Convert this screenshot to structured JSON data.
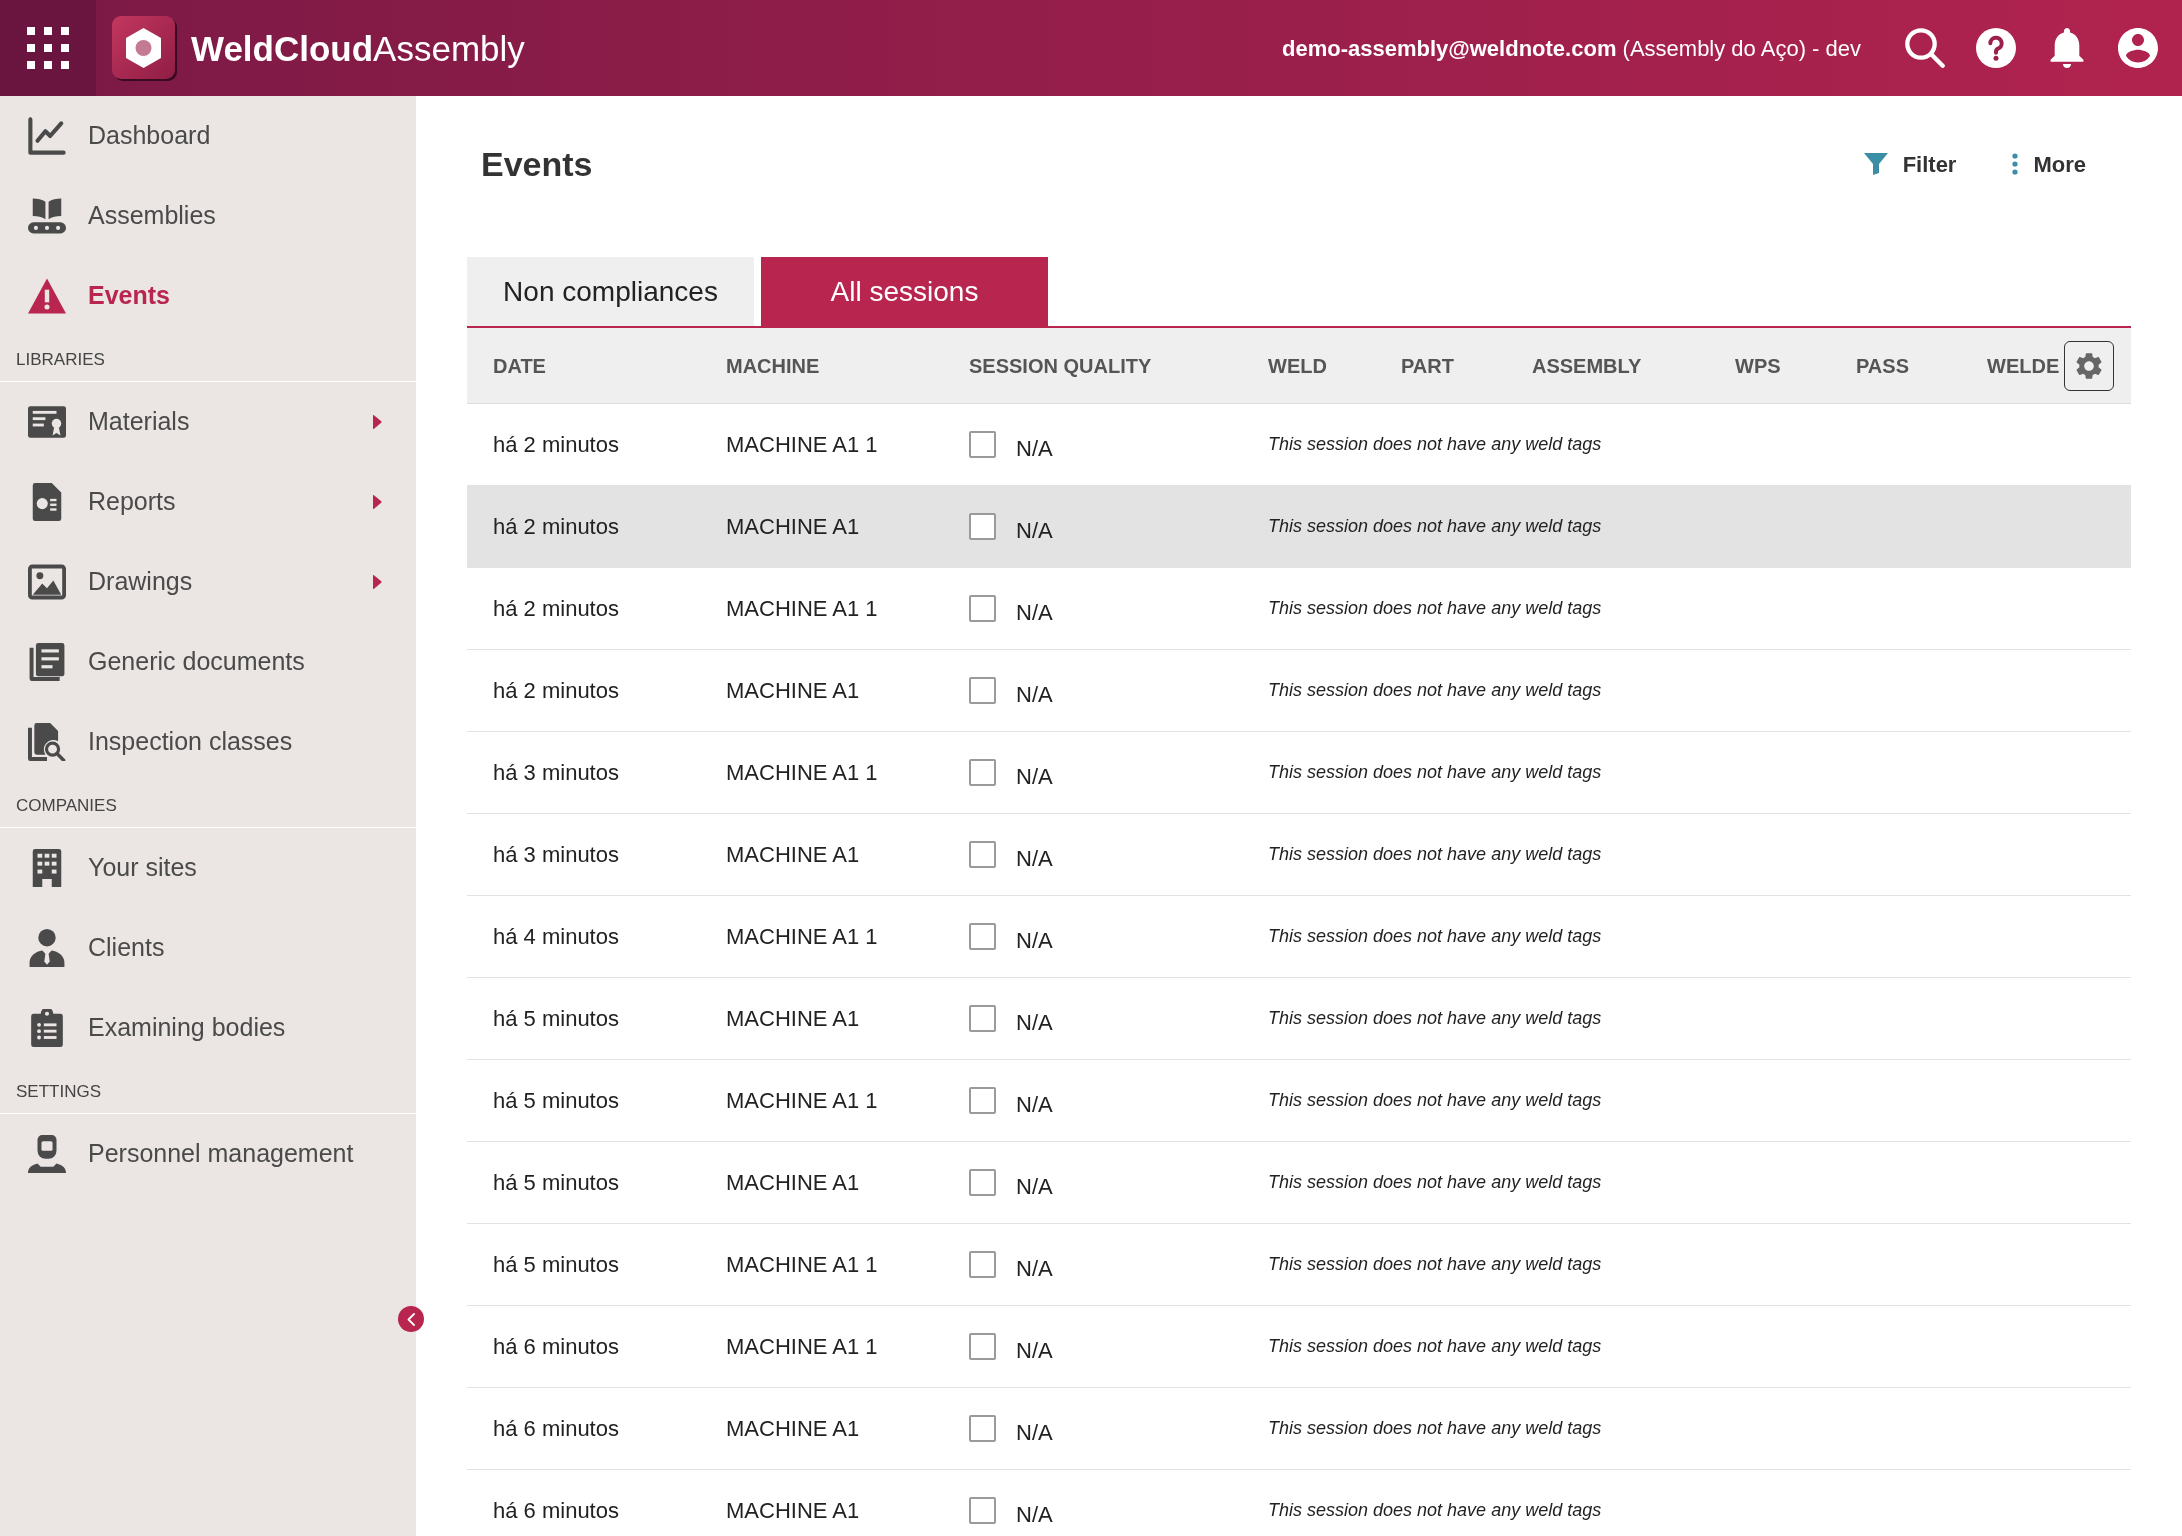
{
  "header": {
    "app_title": "**WeldCloud**Assembly",
    "user_info": "**demo-assembly@weldnote.com** (Assembly do Aço) - dev"
  },
  "sidebar": {
    "sections": [
      {
        "items": [
          {
            "label": "Dashboard",
            "selected": false,
            "has_submenu": false
          },
          {
            "label": "Assemblies",
            "selected": false,
            "has_submenu": false
          },
          {
            "label": "Events",
            "selected": true,
            "has_submenu": false
          }
        ]
      },
      {
        "title": "LIBRARIES",
        "items": [
          {
            "label": "Materials",
            "selected": false,
            "has_submenu": true
          },
          {
            "label": "Reports",
            "selected": false,
            "has_submenu": true
          },
          {
            "label": "Drawings",
            "selected": false,
            "has_submenu": true
          },
          {
            "label": "Generic documents",
            "selected": false,
            "has_submenu": false
          },
          {
            "label": "Inspection classes",
            "selected": false,
            "has_submenu": false
          }
        ]
      },
      {
        "title": "COMPANIES",
        "items": [
          {
            "label": "Your sites",
            "selected": false,
            "has_submenu": false
          },
          {
            "label": "Clients",
            "selected": false,
            "has_submenu": false
          },
          {
            "label": "Examining bodies",
            "selected": false,
            "has_submenu": false
          }
        ]
      },
      {
        "title": "SETTINGS",
        "items": [
          {
            "label": "Personnel management",
            "selected": false,
            "has_submenu": false
          }
        ]
      }
    ]
  },
  "page": {
    "title": "Events",
    "actions": [
      {
        "label": "Filter"
      },
      {
        "label": "More"
      }
    ]
  },
  "tabs": [
    {
      "label": "Non compliances",
      "selected": false
    },
    {
      "label": "All sessions",
      "selected": true
    }
  ],
  "table": {
    "columns": [
      "DATE",
      "MACHINE",
      "SESSION QUALITY",
      "WELD",
      "PART",
      "ASSEMBLY",
      "WPS",
      "PASS",
      "WELDE"
    ],
    "rows": [
      {
        "date": "há 2 minutos",
        "machine": "MACHINE A1 1",
        "quality_checked": false,
        "quality": "N/A",
        "weld_tags": "This session does not have any weld tags",
        "highlighted": false
      },
      {
        "date": "há 2 minutos",
        "machine": "MACHINE A1",
        "quality_checked": false,
        "quality": "N/A",
        "weld_tags": "This session does not have any weld tags",
        "highlighted": true
      },
      {
        "date": "há 2 minutos",
        "machine": "MACHINE A1 1",
        "quality_checked": false,
        "quality": "N/A",
        "weld_tags": "This session does not have any weld tags",
        "highlighted": false
      },
      {
        "date": "há 2 minutos",
        "machine": "MACHINE A1",
        "quality_checked": false,
        "quality": "N/A",
        "weld_tags": "This session does not have any weld tags",
        "highlighted": false
      },
      {
        "date": "há 3 minutos",
        "machine": "MACHINE A1 1",
        "quality_checked": false,
        "quality": "N/A",
        "weld_tags": "This session does not have any weld tags",
        "highlighted": false
      },
      {
        "date": "há 3 minutos",
        "machine": "MACHINE A1",
        "quality_checked": false,
        "quality": "N/A",
        "weld_tags": "This session does not have any weld tags",
        "highlighted": false
      },
      {
        "date": "há 4 minutos",
        "machine": "MACHINE A1 1",
        "quality_checked": false,
        "quality": "N/A",
        "weld_tags": "This session does not have any weld tags",
        "highlighted": false
      },
      {
        "date": "há 5 minutos",
        "machine": "MACHINE A1",
        "quality_checked": false,
        "quality": "N/A",
        "weld_tags": "This session does not have any weld tags",
        "highlighted": false
      },
      {
        "date": "há 5 minutos",
        "machine": "MACHINE A1 1",
        "quality_checked": false,
        "quality": "N/A",
        "weld_tags": "This session does not have any weld tags",
        "highlighted": false
      },
      {
        "date": "há 5 minutos",
        "machine": "MACHINE A1",
        "quality_checked": false,
        "quality": "N/A",
        "weld_tags": "This session does not have any weld tags",
        "highlighted": false
      },
      {
        "date": "há 5 minutos",
        "machine": "MACHINE A1 1",
        "quality_checked": false,
        "quality": "N/A",
        "weld_tags": "This session does not have any weld tags",
        "highlighted": false
      },
      {
        "date": "há 6 minutos",
        "machine": "MACHINE A1 1",
        "quality_checked": false,
        "quality": "N/A",
        "weld_tags": "This session does not have any weld tags",
        "highlighted": false
      },
      {
        "date": "há 6 minutos",
        "machine": "MACHINE A1",
        "quality_checked": false,
        "quality": "N/A",
        "weld_tags": "This session does not have any weld tags",
        "highlighted": false
      },
      {
        "date": "há 6 minutos",
        "machine": "MACHINE A1",
        "quality_checked": false,
        "quality": "N/A",
        "weld_tags": "This session does not have any weld tags",
        "highlighted": false
      }
    ]
  }
}
